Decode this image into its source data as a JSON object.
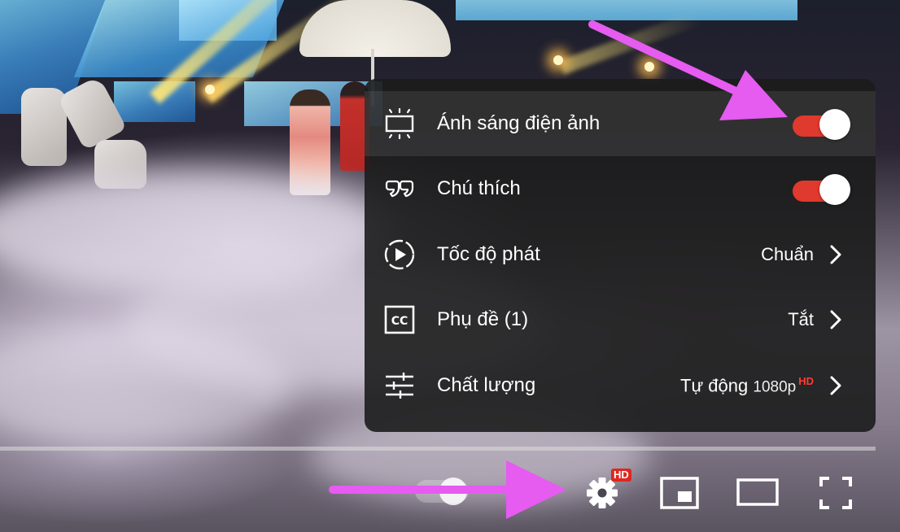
{
  "settings_menu": {
    "items": [
      {
        "icon": "ambient-mode-icon",
        "label": "Ánh sáng điện ảnh",
        "control": "toggle",
        "on": true
      },
      {
        "icon": "annotations-icon",
        "label": "Chú thích",
        "control": "toggle",
        "on": true
      },
      {
        "icon": "playback-speed-icon",
        "label": "Tốc độ phát",
        "value": "Chuẩn"
      },
      {
        "icon": "subtitles-icon",
        "label": "Phụ đề (1)",
        "value": "Tắt"
      },
      {
        "icon": "quality-icon",
        "label": "Chất lượng",
        "value": "Tự động",
        "value_sub": "1080p",
        "badge": "HD"
      }
    ]
  },
  "controls": {
    "settings_badge": "HD",
    "buttons": [
      "settings-gear-icon",
      "miniplayer-icon",
      "theater-mode-icon",
      "fullscreen-icon"
    ]
  },
  "colors": {
    "toggle_on": "#e0392d",
    "hd_badge": "#e0261f",
    "annotation_arrow": "#e65bf0",
    "panel_bg": "#1c1c1c"
  }
}
